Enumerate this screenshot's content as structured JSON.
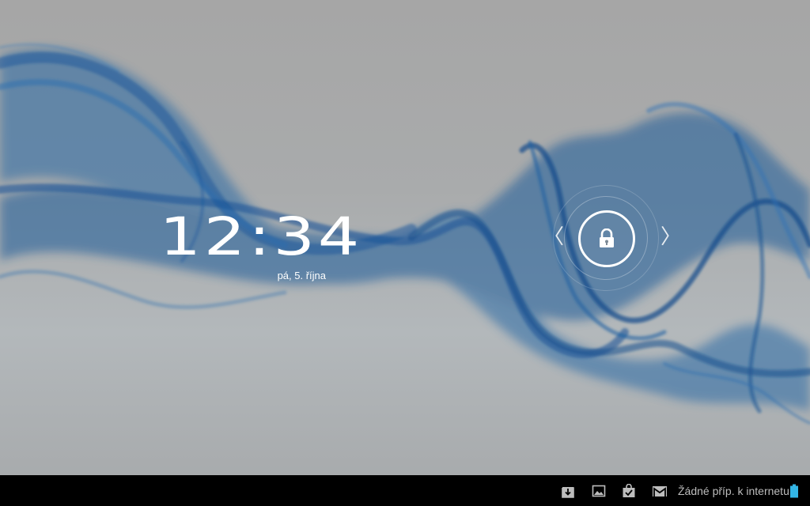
{
  "lockscreen": {
    "time": "12:34",
    "date": "pá, 5. října",
    "unlock_icon": "lock-icon",
    "left_arrow": "〈",
    "right_arrow": "〉"
  },
  "status_bar": {
    "notification_icons": [
      "download-icon",
      "image-icon",
      "shopping-bag-icon",
      "gmail-icon"
    ],
    "connection_text": "Žádné příp. k internetu",
    "battery_icon": "battery-icon"
  },
  "colors": {
    "wallpaper_gray": "#a6a6a6",
    "wave_blue": "#1f5f9e",
    "status_bar": "#000000",
    "battery": "#33b5e5"
  }
}
